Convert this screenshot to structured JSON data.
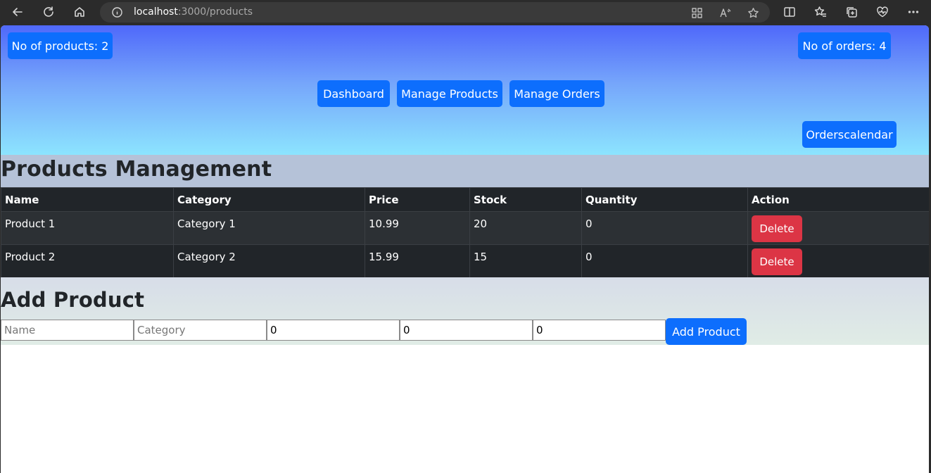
{
  "browser": {
    "url_host": "localhost",
    "url_path": ":3000/products"
  },
  "header": {
    "products_count_label": "No of products: 2",
    "orders_count_label": "No of orders: 4",
    "nav": {
      "dashboard": "Dashboard",
      "manage_products": "Manage Products",
      "manage_orders": "Manage Orders"
    },
    "calendar_button": "Orderscalendar"
  },
  "products": {
    "title": "Products Management",
    "columns": [
      "Name",
      "Category",
      "Price",
      "Stock",
      "Quantity",
      "Action"
    ],
    "rows": [
      {
        "name": "Product 1",
        "category": "Category 1",
        "price": "10.99",
        "stock": "20",
        "quantity": "0",
        "action": "Delete"
      },
      {
        "name": "Product 2",
        "category": "Category 2",
        "price": "15.99",
        "stock": "15",
        "quantity": "0",
        "action": "Delete"
      }
    ]
  },
  "add_product": {
    "title": "Add Product",
    "name_placeholder": "Name",
    "category_placeholder": "Category",
    "price_value": "0",
    "stock_value": "0",
    "quantity_value": "0",
    "submit_label": "Add Product"
  }
}
